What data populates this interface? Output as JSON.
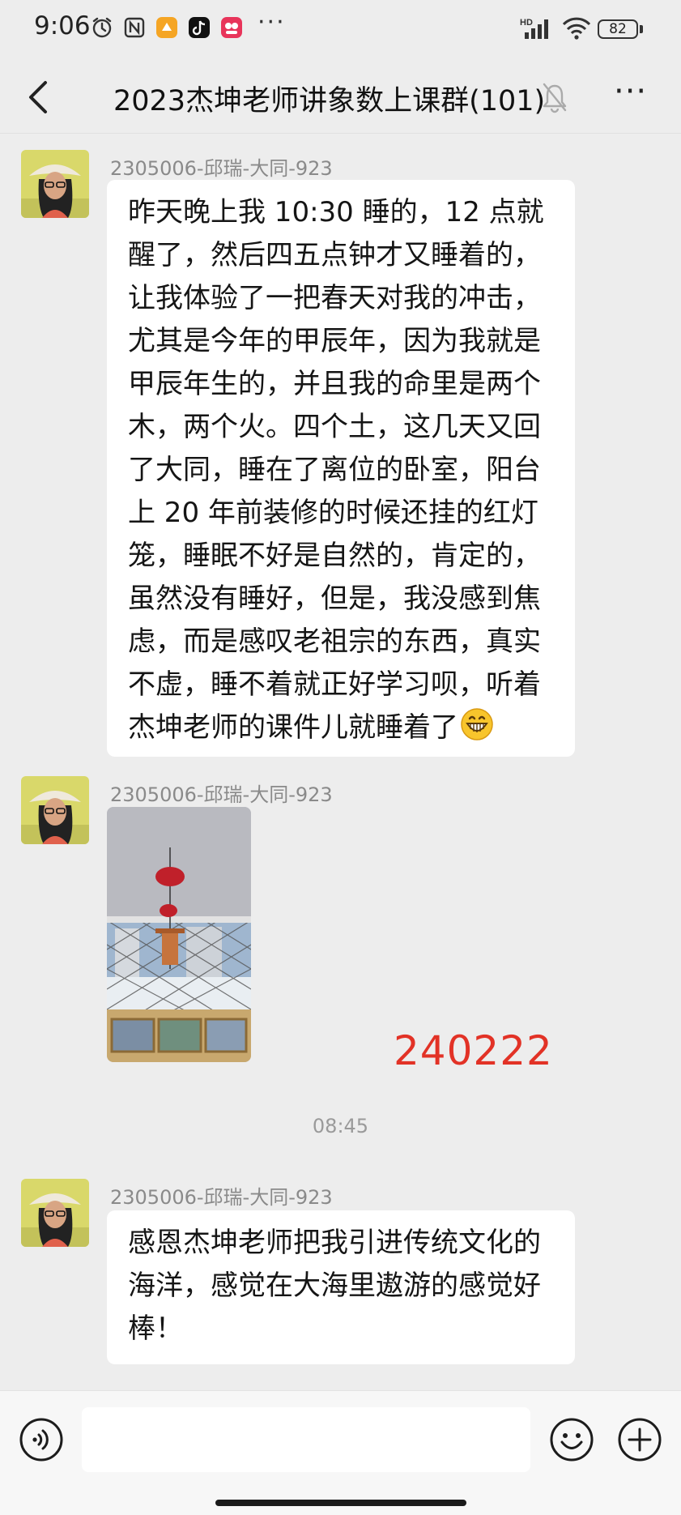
{
  "status_bar": {
    "time": "9:06",
    "network": "HD",
    "battery": "82",
    "more": "···",
    "icons": [
      "alarm-icon",
      "nfc-icon",
      "app-icon-orange",
      "tiktok-icon",
      "app-icon-red"
    ]
  },
  "header": {
    "title": "2023杰坤老师讲象数上课群(101)",
    "back_icon": "back-arrow-icon",
    "muted_icon": "bell-muted-icon",
    "more_icon": "more-icon"
  },
  "messages": [
    {
      "sender": "2305006-邱瑞-大同-923",
      "type": "text",
      "text": "昨天晚上我 10:30 睡的，12 点就醒了，然后四五点钟才又睡着的，让我体验了一把春天对我的冲击，尤其是今年的甲辰年，因为我就是甲辰年生的，并且我的命里是两个木，两个火。四个土，这几天又回了大同，睡在了离位的卧室，阳台上 20 年前装修的时候还挂的红灯笼，睡眠不好是自然的，肯定的，虽然没有睡好，但是，我没感到焦虑，而是感叹老祖宗的东西，真实不虚，睡不着就正好学习呗，听着杰坤老师的课件儿就睡着了",
      "emoji": "grinning-face-icon"
    },
    {
      "sender": "2305006-邱瑞-大同-923",
      "type": "image",
      "stamp": "240222"
    },
    {
      "sender": "2305006-邱瑞-大同-923",
      "type": "text",
      "text": "感恩杰坤老师把我引进传统文化的海洋，感觉在大海里遨游的感觉好棒！"
    }
  ],
  "timestamp": "08:45",
  "input_bar": {
    "voice_icon": "voice-icon",
    "input_value": "",
    "emoji_icon": "emoji-icon",
    "plus_icon": "plus-icon"
  },
  "colors": {
    "background": "#ededed",
    "bubble": "#ffffff",
    "stamp": "#e23226",
    "sender": "#8a8a8a"
  }
}
